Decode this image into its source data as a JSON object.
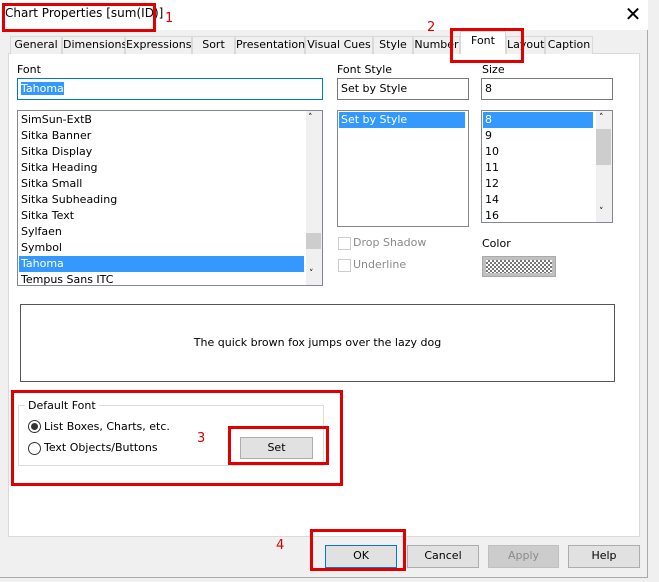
{
  "window": {
    "title": "Chart Properties [sum(ID)]",
    "close_icon": "close-icon"
  },
  "tabs": [
    "General",
    "Dimensions",
    "Expressions",
    "Sort",
    "Presentation",
    "Visual Cues",
    "Style",
    "Number",
    "Font",
    "Layout",
    "Caption"
  ],
  "selected_tab": "Font",
  "font": {
    "label": "Font",
    "value": "Tahoma",
    "items": [
      "SimSun-ExtB",
      "Sitka Banner",
      "Sitka Display",
      "Sitka Heading",
      "Sitka Small",
      "Sitka Subheading",
      "Sitka Text",
      "Sylfaen",
      "Symbol",
      "Tahoma",
      "Tempus Sans ITC"
    ],
    "selected": "Tahoma"
  },
  "font_style": {
    "label": "Font Style",
    "value": "Set by Style",
    "items": [
      "Set by Style"
    ],
    "selected": "Set by Style"
  },
  "size": {
    "label": "Size",
    "value": "8",
    "items": [
      "8",
      "9",
      "10",
      "11",
      "12",
      "14",
      "16"
    ],
    "selected": "8"
  },
  "effects": {
    "drop_shadow": "Drop Shadow",
    "underline": "Underline",
    "drop_shadow_checked": false,
    "underline_checked": false
  },
  "color": {
    "label": "Color"
  },
  "preview": {
    "text": "The quick brown fox jumps over the lazy dog"
  },
  "default_font": {
    "label": "Default Font",
    "options": [
      "List Boxes, Charts, etc.",
      "Text Objects/Buttons"
    ],
    "selected": "List Boxes, Charts, etc.",
    "set_label": "Set"
  },
  "buttons": {
    "ok": "OK",
    "cancel": "Cancel",
    "apply": "Apply",
    "help": "Help"
  },
  "annotations": [
    "1",
    "2",
    "3",
    "4"
  ],
  "colors": {
    "annotation": "#e00000",
    "selection": "#3399ff"
  }
}
